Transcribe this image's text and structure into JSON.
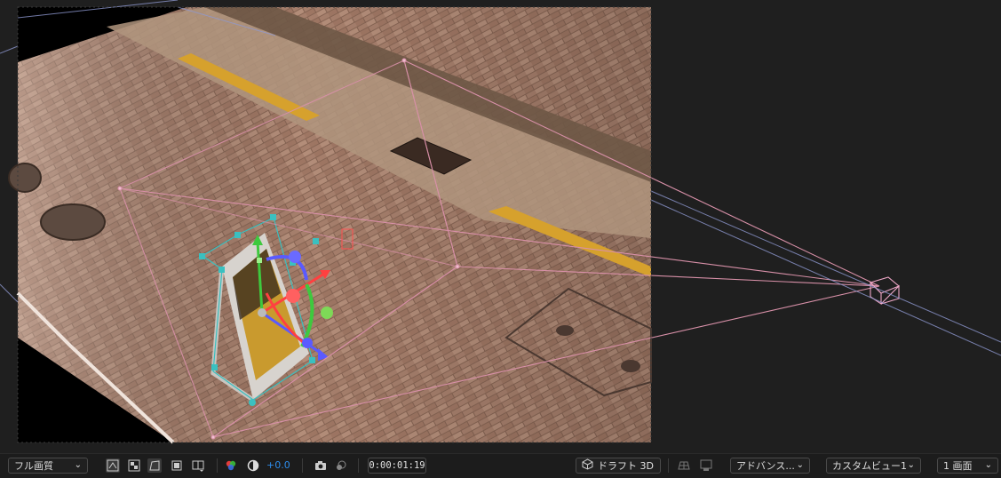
{
  "toolbar": {
    "resolution_label": "フル画質",
    "exposure_value": "+0.0",
    "timecode": "0:00:01:19",
    "draft3d_label": "ドラフト 3D",
    "renderer_label": "アドバンス...",
    "view_label": "カスタムビュー1",
    "layout_label": "1 画面"
  },
  "icons": [
    "chevron-down-icon",
    "fast-previews-icon",
    "transparency-grid-icon",
    "mask-path-icon",
    "region-of-interest-icon",
    "safe-margins-icon",
    "color-channels-icon",
    "exposure-reset-icon",
    "camera-snapshot-icon",
    "show-snapshot-icon",
    "draft3d-icon",
    "ground-plane-icon",
    "extended-viewer-icon"
  ],
  "colors": {
    "panel_bg": "#1c1c1c",
    "accent_blue": "#2d8ceb",
    "camera_wire": "#d890a8",
    "gizmo_x": "#ff4040",
    "gizmo_y": "#3ec93e",
    "gizmo_z": "#5a5aff"
  }
}
